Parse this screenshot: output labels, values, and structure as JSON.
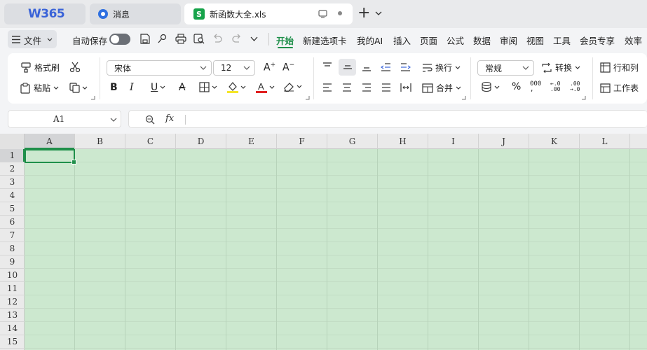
{
  "tabs": {
    "w365": "W365",
    "messages": "消息",
    "document": "新函数大全.xls",
    "doc_icon": "S",
    "new_tab": "+"
  },
  "menubar": {
    "file": "文件",
    "autosave": "自动保存",
    "items": [
      "开始",
      "新建选项卡",
      "我的AI",
      "插入",
      "页面",
      "公式",
      "数据",
      "审阅",
      "视图",
      "工具",
      "会员专享",
      "效率"
    ]
  },
  "ribbon": {
    "format_painter": "格式刷",
    "paste": "粘贴",
    "font_name": "宋体",
    "font_size": "12",
    "wrap": "换行",
    "merge": "合并",
    "number_format": "常规",
    "convert": "转换",
    "rows_cols": "行和列",
    "worksheet": "工作表"
  },
  "formula_bar": {
    "name_box": "A1",
    "fx": "fx",
    "value": ""
  },
  "sheet": {
    "columns": [
      "A",
      "B",
      "C",
      "D",
      "E",
      "F",
      "G",
      "H",
      "I",
      "J",
      "K",
      "L"
    ],
    "rows": [
      "1",
      "2",
      "3",
      "4",
      "5",
      "6",
      "7",
      "8",
      "9",
      "10",
      "11",
      "12",
      "13",
      "14",
      "15"
    ],
    "selected_cell": "A1"
  },
  "colors": {
    "accent": "#1f8f4a",
    "cell_fill": "#cce8cf",
    "w365_blue": "#3a63d8"
  }
}
